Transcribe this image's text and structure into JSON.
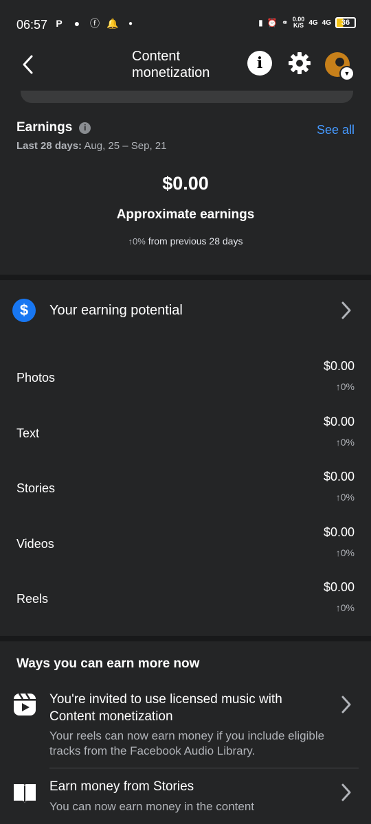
{
  "status_bar": {
    "time": "06:57",
    "left_icons": [
      "p-icon",
      "chat-icon",
      "facebook-icon",
      "bell-icon",
      "dot-icon"
    ],
    "net_speed_value": "0.00",
    "net_speed_unit": "K/S",
    "signal_1": "4G",
    "signal_2": "4G",
    "battery": "36"
  },
  "header": {
    "title": "Content monetization",
    "info_label": "i"
  },
  "earnings": {
    "title": "Earnings",
    "see_all": "See all",
    "range_label": "Last 28 days:",
    "range_value": "Aug, 25 – Sep, 21",
    "amount": "$0.00",
    "amount_label": "Approximate earnings",
    "change_pct": "↑0%",
    "change_text": "from previous 28 days"
  },
  "potential": {
    "icon_symbol": "$",
    "label": "Your earning potential"
  },
  "breakdown": [
    {
      "label": "Photos",
      "value": "$0.00",
      "change": "↑0%"
    },
    {
      "label": "Text",
      "value": "$0.00",
      "change": "↑0%"
    },
    {
      "label": "Stories",
      "value": "$0.00",
      "change": "↑0%"
    },
    {
      "label": "Videos",
      "value": "$0.00",
      "change": "↑0%"
    },
    {
      "label": "Reels",
      "value": "$0.00",
      "change": "↑0%"
    }
  ],
  "ways": {
    "title": "Ways you can earn more now",
    "items": [
      {
        "icon": "reels-icon",
        "title": "You're invited to use licensed music with Content monetization",
        "desc": "Your reels can now earn money if you include eligible tracks from the Facebook Audio Library."
      },
      {
        "icon": "book-icon",
        "title": "Earn money from Stories",
        "desc": "You can now earn money in the content"
      }
    ]
  },
  "colors": {
    "background": "#242526",
    "accent_link": "#4599ff",
    "dollar_badge": "#1877f2"
  }
}
